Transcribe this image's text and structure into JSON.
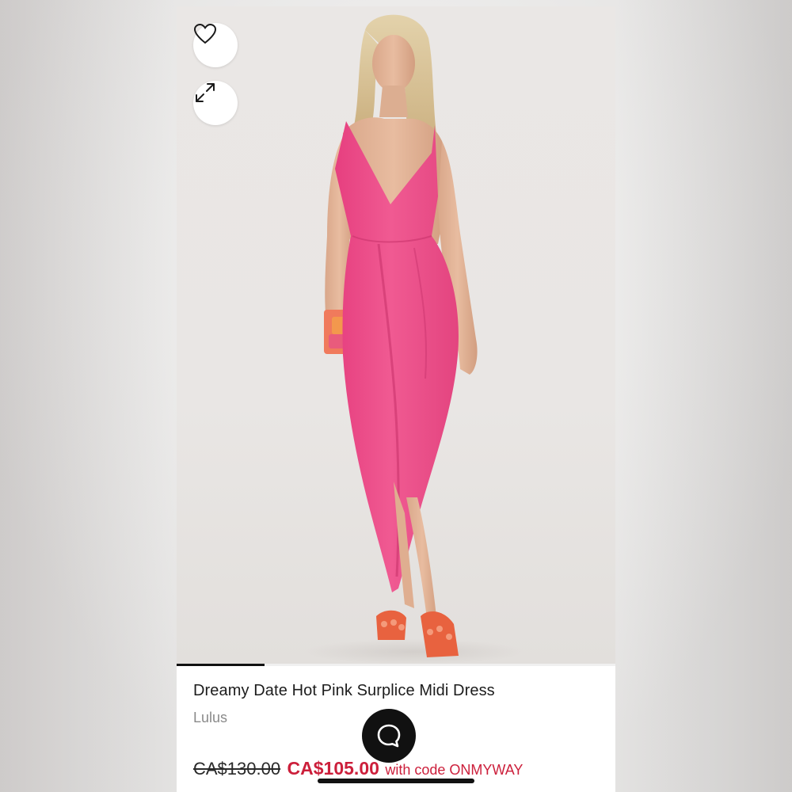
{
  "product": {
    "title": "Dreamy Date Hot Pink Surplice Midi Dress",
    "brand": "Lulus",
    "price_original": "CA$130.00",
    "price_sale": "CA$105.00",
    "promo_text": "with code ONMYWAY"
  },
  "gallery": {
    "image_description_icon": "product-photo",
    "progress_fraction": 0.2
  },
  "actions": {
    "favorite_icon": "heart-icon",
    "expand_icon": "expand-icon",
    "chat_icon": "chat-bubble-icon"
  },
  "colors": {
    "sale_red": "#cc1f3b",
    "dress_pink": "#ec4d88"
  }
}
